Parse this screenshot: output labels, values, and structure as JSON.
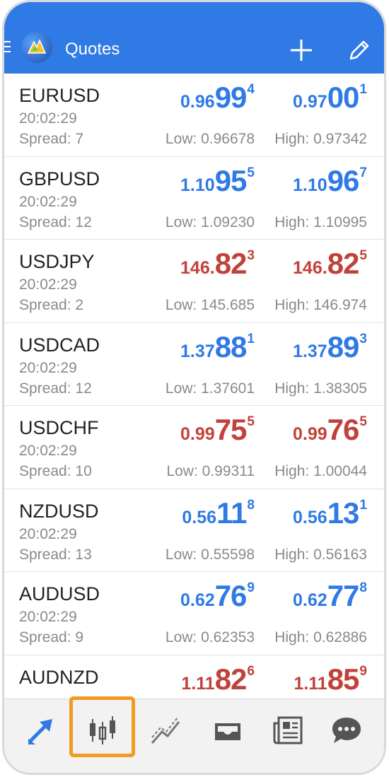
{
  "header": {
    "title": "Quotes",
    "menu_icon": "hamburger-icon",
    "logo_icon": "metatrader-logo-icon",
    "add_icon": "plus-icon",
    "edit_icon": "pencil-icon"
  },
  "colors": {
    "accent": "#2f7ae5",
    "down": "#c0423a",
    "highlight": "#f29a22"
  },
  "quotes": [
    {
      "symbol": "EURUSD",
      "time": "20:02:29",
      "spread": "Spread: 7",
      "low": "Low: 0.96678",
      "high": "High: 0.97342",
      "bid": {
        "prefix": "0.96",
        "big": "99",
        "sup": "4"
      },
      "ask": {
        "prefix": "0.97",
        "big": "00",
        "sup": "1"
      },
      "color": "blue"
    },
    {
      "symbol": "GBPUSD",
      "time": "20:02:29",
      "spread": "Spread: 12",
      "low": "Low: 1.09230",
      "high": "High: 1.10995",
      "bid": {
        "prefix": "1.10",
        "big": "95",
        "sup": "5"
      },
      "ask": {
        "prefix": "1.10",
        "big": "96",
        "sup": "7"
      },
      "color": "blue"
    },
    {
      "symbol": "USDJPY",
      "time": "20:02:29",
      "spread": "Spread: 2",
      "low": "Low: 145.685",
      "high": "High: 146.974",
      "bid": {
        "prefix": "146.",
        "big": "82",
        "sup": "3"
      },
      "ask": {
        "prefix": "146.",
        "big": "82",
        "sup": "5"
      },
      "color": "red"
    },
    {
      "symbol": "USDCAD",
      "time": "20:02:29",
      "spread": "Spread: 12",
      "low": "Low: 1.37601",
      "high": "High: 1.38305",
      "bid": {
        "prefix": "1.37",
        "big": "88",
        "sup": "1"
      },
      "ask": {
        "prefix": "1.37",
        "big": "89",
        "sup": "3"
      },
      "color": "blue"
    },
    {
      "symbol": "USDCHF",
      "time": "20:02:29",
      "spread": "Spread: 10",
      "low": "Low: 0.99311",
      "high": "High: 1.00044",
      "bid": {
        "prefix": "0.99",
        "big": "75",
        "sup": "5"
      },
      "ask": {
        "prefix": "0.99",
        "big": "76",
        "sup": "5"
      },
      "color": "red"
    },
    {
      "symbol": "NZDUSD",
      "time": "20:02:29",
      "spread": "Spread: 13",
      "low": "Low: 0.55598",
      "high": "High: 0.56163",
      "bid": {
        "prefix": "0.56",
        "big": "11",
        "sup": "8"
      },
      "ask": {
        "prefix": "0.56",
        "big": "13",
        "sup": "1"
      },
      "color": "blue"
    },
    {
      "symbol": "AUDUSD",
      "time": "20:02:29",
      "spread": "Spread: 9",
      "low": "Low: 0.62353",
      "high": "High: 0.62886",
      "bid": {
        "prefix": "0.62",
        "big": "76",
        "sup": "9"
      },
      "ask": {
        "prefix": "0.62",
        "big": "77",
        "sup": "8"
      },
      "color": "blue"
    },
    {
      "symbol": "AUDNZD",
      "time": "",
      "spread": "",
      "low": "",
      "high": "",
      "bid": {
        "prefix": "1.11",
        "big": "82",
        "sup": "6"
      },
      "ask": {
        "prefix": "1.11",
        "big": "85",
        "sup": "9"
      },
      "color": "red"
    }
  ],
  "bottom_nav": {
    "items": [
      "quotes-arrows-icon",
      "candlestick-chart-icon",
      "trade-chart-icon",
      "inbox-tray-icon",
      "news-icon",
      "chat-bubble-icon"
    ],
    "selected": "candlestick-chart-icon"
  }
}
